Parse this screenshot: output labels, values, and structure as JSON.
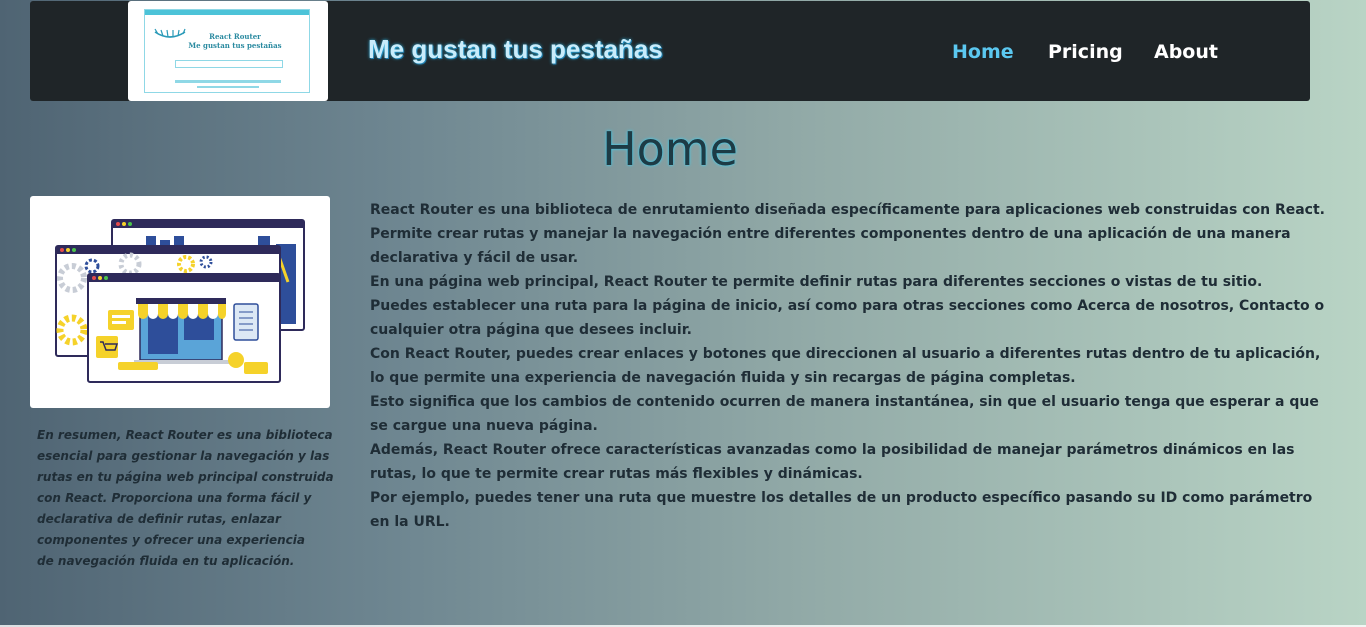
{
  "header": {
    "logo": {
      "text_line1": "React Router",
      "text_line2": "Me gustan tus pestañas",
      "icon": "eyelashes-icon"
    },
    "title": "Me gustan tus pestañas",
    "nav": [
      {
        "label": "Home",
        "active": true
      },
      {
        "label": "Pricing",
        "active": false
      },
      {
        "label": "About",
        "active": false
      }
    ]
  },
  "main": {
    "heading": "Home",
    "illustration": {
      "icon": "web-browser-store-illustration"
    },
    "caption_lines": [
      "En resumen, React Router es una biblioteca",
      "esencial para gestionar la navegación y las",
      "rutas en tu página web principal construida",
      "con React. Proporciona una forma fácil y",
      "declarativa de definir rutas, enlazar",
      "componentes y ofrecer una experiencia",
      "de navegación fluida en tu aplicación."
    ],
    "body_lines": [
      "React Router es una biblioteca de enrutamiento diseñada específicamente para aplicaciones web construidas con React.",
      "Permite crear rutas y manejar la navegación entre diferentes componentes dentro de una aplicación de una manera",
      "declarativa y fácil de usar.",
      "En una página web principal, React Router te permite definir rutas para diferentes secciones o vistas de tu sitio.",
      "Puedes establecer una ruta para la página de inicio, así como para otras secciones como Acerca de nosotros, Contacto o",
      "cualquier otra página que desees incluir.",
      "Con React Router, puedes crear enlaces y botones que direccionen al usuario a diferentes rutas dentro de tu aplicación,",
      "lo que permite una experiencia de navegación fluida y sin recargas de página completas.",
      "Esto significa que los cambios de contenido ocurren de manera instantánea, sin que el usuario tenga que esperar a que",
      "se cargue una nueva página.",
      "Además, React Router ofrece características avanzadas como la posibilidad de manejar parámetros dinámicos en las",
      "rutas, lo que te permite crear rutas más flexibles y dinámicas.",
      "Por ejemplo, puedes tener una ruta que muestre los detalles de un producto específico pasando su ID como parámetro",
      "en la URL."
    ]
  },
  "colors": {
    "nav_bg": "#1f2528",
    "nav_active": "#5bc8f0",
    "heading_glow": "#3fd0f0",
    "text": "#1f2d36"
  }
}
